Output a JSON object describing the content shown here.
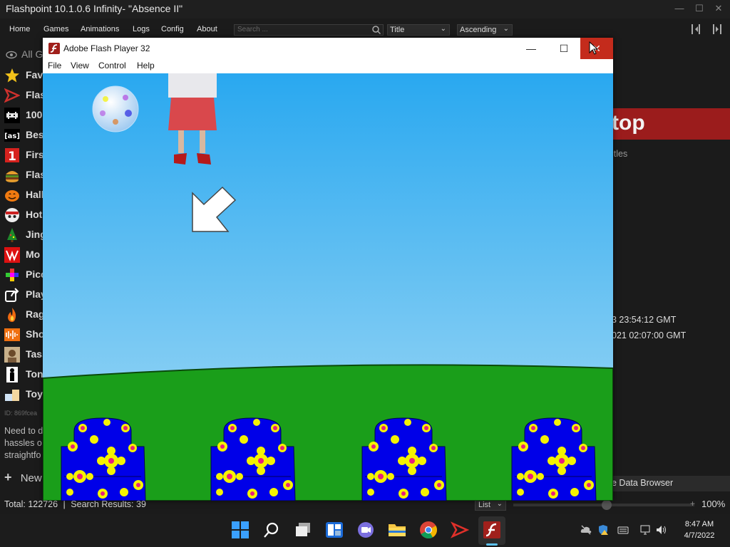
{
  "app": {
    "title": "Flashpoint 10.1.0.6 Infinity- \"Absence II\"",
    "window_controls": {
      "minimize": "—",
      "maximize": "☐",
      "close": "✕"
    }
  },
  "menu": {
    "items": [
      "Home",
      "Games",
      "Animations",
      "Logs",
      "Config",
      "About"
    ],
    "search_placeholder": "Search ...",
    "sort_field": "Title",
    "sort_order": "Ascending"
  },
  "sidebar": {
    "top_label": "All G",
    "items": [
      {
        "label": "Fav",
        "icon": "star-icon"
      },
      {
        "label": "Flas",
        "icon": "flashpoint-icon"
      },
      {
        "label": "100",
        "icon": "space-invader-icon"
      },
      {
        "label": "Bes",
        "icon": "actionscript-icon"
      },
      {
        "label": "Firs",
        "icon": "number-one-icon"
      },
      {
        "label": "Flas",
        "icon": "burger-icon"
      },
      {
        "label": "Hall",
        "icon": "pumpkin-icon"
      },
      {
        "label": "Hot",
        "icon": "skull-icon"
      },
      {
        "label": "Jing",
        "icon": "christmas-tree-icon"
      },
      {
        "label": "Mo",
        "icon": "mosaic-icon"
      },
      {
        "label": "Pico",
        "icon": "pixel-icon"
      },
      {
        "label": "Play",
        "icon": "share-icon"
      },
      {
        "label": "Rag",
        "icon": "fire-icon"
      },
      {
        "label": "Sho",
        "icon": "audio-icon"
      },
      {
        "label": "Tass",
        "icon": "portrait-icon"
      },
      {
        "label": "Ton",
        "icon": "silhouette-icon"
      },
      {
        "label": "Toys",
        "icon": "blocks-icon"
      }
    ],
    "id_text": "ID: 869fcea",
    "description_lines": [
      "Need to d",
      "hassles o",
      "straightfo"
    ],
    "new_label": "New"
  },
  "right_panel": {
    "banner": "top",
    "subtitle": "itles",
    "date_one": "3 23:54:12 GMT",
    "date_two": "021 02:07:00 GMT",
    "data_browser": "e Data Browser"
  },
  "status": {
    "total": "Total: 122726",
    "separator": "|",
    "results": "Search Results: 39",
    "view_mode": "List",
    "zoom": "100%"
  },
  "flash": {
    "title": "Adobe Flash Player 32",
    "menu": [
      "File",
      "View",
      "Control",
      "Help"
    ]
  },
  "taskbar": {
    "time": "8:47 AM",
    "date": "4/7/2022"
  },
  "colors": {
    "sky_top": "#29a8f0",
    "sky_bottom": "#a8dcf5",
    "grass": "#1a9e1a",
    "chair_blue": "#0000e8",
    "flower_yellow": "#f5f200",
    "flower_center": "#e8207a",
    "close_red": "#c42b1c"
  }
}
